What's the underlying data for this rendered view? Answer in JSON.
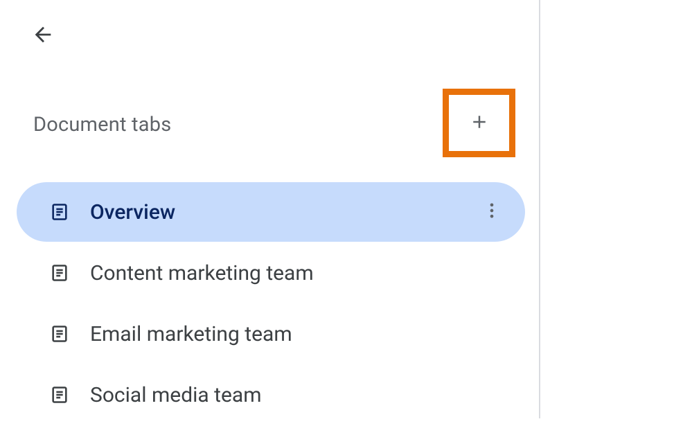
{
  "header": {
    "title": "Document tabs"
  },
  "tabs": [
    {
      "label": "Overview",
      "selected": true
    },
    {
      "label": "Content marketing team",
      "selected": false
    },
    {
      "label": "Email marketing team",
      "selected": false
    },
    {
      "label": "Social media team",
      "selected": false
    }
  ],
  "colors": {
    "highlight_border": "#e8710a",
    "selected_bg": "#c6dbfc",
    "selected_fg": "#0b2661",
    "text_muted": "#5f6368",
    "text_default": "#3c4043"
  }
}
